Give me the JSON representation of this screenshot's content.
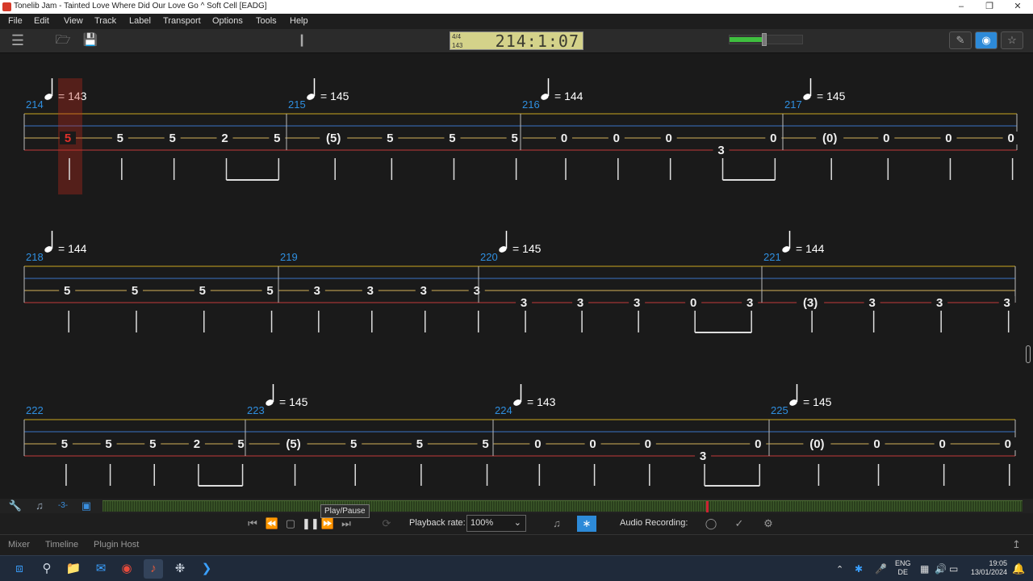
{
  "window": {
    "title": "Tonelib Jam - Tainted Love Where Did Our Love Go ^ Soft Cell  [EADG]"
  },
  "menu": [
    "File",
    "Edit",
    "View",
    "Track",
    "Label",
    "Transport",
    "Options",
    "Tools",
    "Help"
  ],
  "lcd": {
    "time_signature": "4/4",
    "tempo": "143",
    "position": "214:1:07"
  },
  "volume_level_fraction": 0.45,
  "score": {
    "colors": {
      "string_E": "#c23b3b",
      "string_A": "#caa520",
      "string_D": "#3a74c7",
      "string_G": "#d4b25a",
      "bar_number": "#2f8fe0"
    },
    "systems": [
      {
        "measures": [
          {
            "number": "214",
            "tempo": "143",
            "notes": [
              {
                "f": "5",
                "s": "D",
                "active": true
              },
              {
                "f": "5",
                "s": "D"
              },
              {
                "f": "5",
                "s": "D"
              },
              {
                "f": "2",
                "s": "D"
              },
              {
                "f": "5",
                "s": "D"
              }
            ]
          },
          {
            "number": "215",
            "tempo": "145",
            "notes": [
              {
                "f": "(5)",
                "s": "D"
              },
              {
                "f": "5",
                "s": "D"
              },
              {
                "f": "5",
                "s": "D"
              },
              {
                "f": "5",
                "s": "D"
              }
            ]
          },
          {
            "number": "216",
            "tempo": "144",
            "notes": [
              {
                "f": "0",
                "s": "D"
              },
              {
                "f": "0",
                "s": "D"
              },
              {
                "f": "0",
                "s": "D"
              },
              {
                "f": "3",
                "s": "E"
              },
              {
                "f": "0",
                "s": "D"
              }
            ]
          },
          {
            "number": "217",
            "tempo": "145",
            "notes": [
              {
                "f": "(0)",
                "s": "D"
              },
              {
                "f": "0",
                "s": "D"
              },
              {
                "f": "0",
                "s": "D"
              },
              {
                "f": "0",
                "s": "D"
              }
            ]
          }
        ]
      },
      {
        "measures": [
          {
            "number": "218",
            "tempo": "144",
            "notes": [
              {
                "f": "5",
                "s": "D"
              },
              {
                "f": "5",
                "s": "D"
              },
              {
                "f": "5",
                "s": "D"
              },
              {
                "f": "5",
                "s": "D"
              }
            ]
          },
          {
            "number": "219",
            "tempo": "",
            "notes": [
              {
                "f": "3",
                "s": "D"
              },
              {
                "f": "3",
                "s": "D"
              },
              {
                "f": "3",
                "s": "D"
              },
              {
                "f": "3",
                "s": "D"
              }
            ]
          },
          {
            "number": "220",
            "tempo": "145",
            "notes": [
              {
                "f": "3",
                "s": "E"
              },
              {
                "f": "3",
                "s": "E"
              },
              {
                "f": "3",
                "s": "E"
              },
              {
                "f": "0",
                "s": "E"
              },
              {
                "f": "3",
                "s": "E"
              }
            ]
          },
          {
            "number": "221",
            "tempo": "144",
            "notes": [
              {
                "f": "(3)",
                "s": "E"
              },
              {
                "f": "3",
                "s": "E"
              },
              {
                "f": "3",
                "s": "E"
              },
              {
                "f": "3",
                "s": "E"
              }
            ]
          }
        ]
      },
      {
        "measures": [
          {
            "number": "222",
            "tempo": "",
            "notes": [
              {
                "f": "5",
                "s": "D"
              },
              {
                "f": "5",
                "s": "D"
              },
              {
                "f": "5",
                "s": "D"
              },
              {
                "f": "2",
                "s": "D"
              },
              {
                "f": "5",
                "s": "D"
              }
            ]
          },
          {
            "number": "223",
            "tempo": "145",
            "notes": [
              {
                "f": "(5)",
                "s": "D"
              },
              {
                "f": "5",
                "s": "D"
              },
              {
                "f": "5",
                "s": "D"
              },
              {
                "f": "5",
                "s": "D"
              }
            ]
          },
          {
            "number": "224",
            "tempo": "143",
            "notes": [
              {
                "f": "0",
                "s": "D"
              },
              {
                "f": "0",
                "s": "D"
              },
              {
                "f": "0",
                "s": "D"
              },
              {
                "f": "3",
                "s": "E"
              },
              {
                "f": "0",
                "s": "D"
              }
            ]
          },
          {
            "number": "225",
            "tempo": "145",
            "notes": [
              {
                "f": "(0)",
                "s": "D"
              },
              {
                "f": "0",
                "s": "D"
              },
              {
                "f": "0",
                "s": "D"
              },
              {
                "f": "0",
                "s": "D"
              }
            ]
          }
        ]
      }
    ]
  },
  "transport": {
    "tooltip": "Play/Pause",
    "rate_label": "Playback rate:",
    "rate_value": "100%",
    "recording_label": "Audio Recording:"
  },
  "tabs": [
    "Mixer",
    "Timeline",
    "Plugin Host"
  ],
  "tray": {
    "lang1": "ENG",
    "lang2": "DE",
    "time": "19:05",
    "date": "13/01/2024"
  },
  "icons": {
    "play": "play-icon",
    "pause": "pause-icon",
    "stop": "stop-icon"
  }
}
